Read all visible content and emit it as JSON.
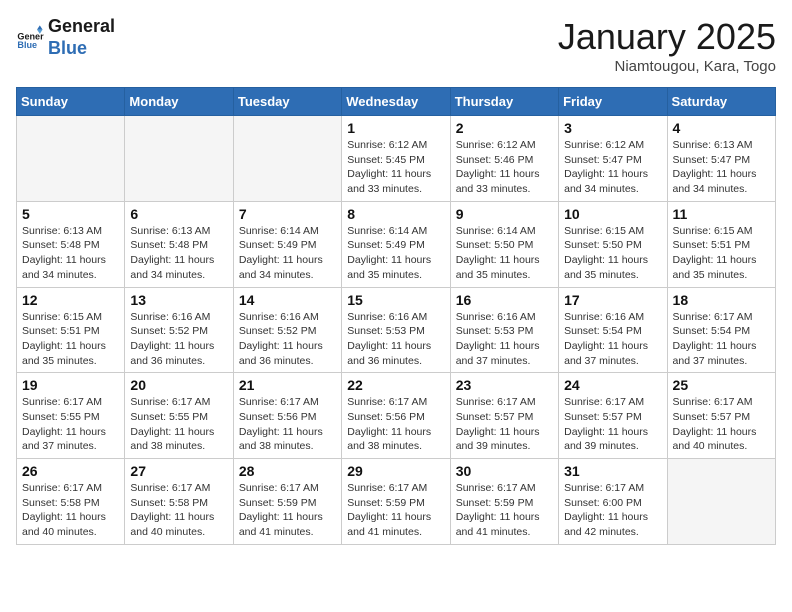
{
  "header": {
    "logo_general": "General",
    "logo_blue": "Blue",
    "month_title": "January 2025",
    "location": "Niamtougou, Kara, Togo"
  },
  "days_of_week": [
    "Sunday",
    "Monday",
    "Tuesday",
    "Wednesday",
    "Thursday",
    "Friday",
    "Saturday"
  ],
  "weeks": [
    [
      {
        "day": "",
        "info": ""
      },
      {
        "day": "",
        "info": ""
      },
      {
        "day": "",
        "info": ""
      },
      {
        "day": "1",
        "info": "Sunrise: 6:12 AM\nSunset: 5:45 PM\nDaylight: 11 hours and 33 minutes."
      },
      {
        "day": "2",
        "info": "Sunrise: 6:12 AM\nSunset: 5:46 PM\nDaylight: 11 hours and 33 minutes."
      },
      {
        "day": "3",
        "info": "Sunrise: 6:12 AM\nSunset: 5:47 PM\nDaylight: 11 hours and 34 minutes."
      },
      {
        "day": "4",
        "info": "Sunrise: 6:13 AM\nSunset: 5:47 PM\nDaylight: 11 hours and 34 minutes."
      }
    ],
    [
      {
        "day": "5",
        "info": "Sunrise: 6:13 AM\nSunset: 5:48 PM\nDaylight: 11 hours and 34 minutes."
      },
      {
        "day": "6",
        "info": "Sunrise: 6:13 AM\nSunset: 5:48 PM\nDaylight: 11 hours and 34 minutes."
      },
      {
        "day": "7",
        "info": "Sunrise: 6:14 AM\nSunset: 5:49 PM\nDaylight: 11 hours and 34 minutes."
      },
      {
        "day": "8",
        "info": "Sunrise: 6:14 AM\nSunset: 5:49 PM\nDaylight: 11 hours and 35 minutes."
      },
      {
        "day": "9",
        "info": "Sunrise: 6:14 AM\nSunset: 5:50 PM\nDaylight: 11 hours and 35 minutes."
      },
      {
        "day": "10",
        "info": "Sunrise: 6:15 AM\nSunset: 5:50 PM\nDaylight: 11 hours and 35 minutes."
      },
      {
        "day": "11",
        "info": "Sunrise: 6:15 AM\nSunset: 5:51 PM\nDaylight: 11 hours and 35 minutes."
      }
    ],
    [
      {
        "day": "12",
        "info": "Sunrise: 6:15 AM\nSunset: 5:51 PM\nDaylight: 11 hours and 35 minutes."
      },
      {
        "day": "13",
        "info": "Sunrise: 6:16 AM\nSunset: 5:52 PM\nDaylight: 11 hours and 36 minutes."
      },
      {
        "day": "14",
        "info": "Sunrise: 6:16 AM\nSunset: 5:52 PM\nDaylight: 11 hours and 36 minutes."
      },
      {
        "day": "15",
        "info": "Sunrise: 6:16 AM\nSunset: 5:53 PM\nDaylight: 11 hours and 36 minutes."
      },
      {
        "day": "16",
        "info": "Sunrise: 6:16 AM\nSunset: 5:53 PM\nDaylight: 11 hours and 37 minutes."
      },
      {
        "day": "17",
        "info": "Sunrise: 6:16 AM\nSunset: 5:54 PM\nDaylight: 11 hours and 37 minutes."
      },
      {
        "day": "18",
        "info": "Sunrise: 6:17 AM\nSunset: 5:54 PM\nDaylight: 11 hours and 37 minutes."
      }
    ],
    [
      {
        "day": "19",
        "info": "Sunrise: 6:17 AM\nSunset: 5:55 PM\nDaylight: 11 hours and 37 minutes."
      },
      {
        "day": "20",
        "info": "Sunrise: 6:17 AM\nSunset: 5:55 PM\nDaylight: 11 hours and 38 minutes."
      },
      {
        "day": "21",
        "info": "Sunrise: 6:17 AM\nSunset: 5:56 PM\nDaylight: 11 hours and 38 minutes."
      },
      {
        "day": "22",
        "info": "Sunrise: 6:17 AM\nSunset: 5:56 PM\nDaylight: 11 hours and 38 minutes."
      },
      {
        "day": "23",
        "info": "Sunrise: 6:17 AM\nSunset: 5:57 PM\nDaylight: 11 hours and 39 minutes."
      },
      {
        "day": "24",
        "info": "Sunrise: 6:17 AM\nSunset: 5:57 PM\nDaylight: 11 hours and 39 minutes."
      },
      {
        "day": "25",
        "info": "Sunrise: 6:17 AM\nSunset: 5:57 PM\nDaylight: 11 hours and 40 minutes."
      }
    ],
    [
      {
        "day": "26",
        "info": "Sunrise: 6:17 AM\nSunset: 5:58 PM\nDaylight: 11 hours and 40 minutes."
      },
      {
        "day": "27",
        "info": "Sunrise: 6:17 AM\nSunset: 5:58 PM\nDaylight: 11 hours and 40 minutes."
      },
      {
        "day": "28",
        "info": "Sunrise: 6:17 AM\nSunset: 5:59 PM\nDaylight: 11 hours and 41 minutes."
      },
      {
        "day": "29",
        "info": "Sunrise: 6:17 AM\nSunset: 5:59 PM\nDaylight: 11 hours and 41 minutes."
      },
      {
        "day": "30",
        "info": "Sunrise: 6:17 AM\nSunset: 5:59 PM\nDaylight: 11 hours and 41 minutes."
      },
      {
        "day": "31",
        "info": "Sunrise: 6:17 AM\nSunset: 6:00 PM\nDaylight: 11 hours and 42 minutes."
      },
      {
        "day": "",
        "info": ""
      }
    ]
  ]
}
